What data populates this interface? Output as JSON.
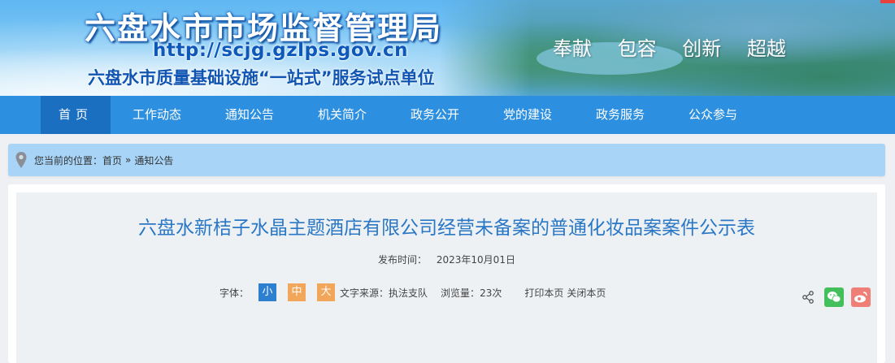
{
  "header": {
    "title": "六盘水市市场监督管理局",
    "url": "http://scjg.gzlps.gov.cn",
    "subtitle": "六盘水市质量基础设施“一站式”服务试点单位",
    "slogans": [
      "奉献",
      "包容",
      "创新",
      "超越"
    ]
  },
  "nav": {
    "items": [
      "首页",
      "工作动态",
      "通知公告",
      "机关简介",
      "政务公开",
      "党的建设",
      "政务服务",
      "公众参与"
    ],
    "active_index": 0
  },
  "breadcrumb": {
    "prefix": "您当前的位置：",
    "home": "首页",
    "separator": "»",
    "current": "通知公告"
  },
  "article": {
    "title": "六盘水新桔子水晶主题酒店有限公司经营未备案的普通化妆品案案件公示表",
    "publish_label": "发布时间：",
    "publish_date": "2023年10月01日",
    "font_label": "字体：",
    "font_small": "小",
    "font_medium": "中",
    "font_large": "大",
    "source_label": "文字来源：",
    "source_value": "执法支队",
    "views_label": "浏览量：",
    "views_value": "23次",
    "print_label": "打印本页",
    "close_label": "关闭本页"
  },
  "share": {
    "icons": [
      "share-icon",
      "wechat-icon",
      "weibo-icon"
    ]
  },
  "colors": {
    "nav_bg": "#2d8fdf",
    "nav_active": "#1a6fc0",
    "breadcrumb_bg": "#a7d4f7",
    "title_color": "#2a77c5",
    "font_small_bg": "#2d7fd0",
    "font_medium_bg": "#f2a65a",
    "wechat": "#43c05c",
    "weibo": "#ef7e76"
  }
}
